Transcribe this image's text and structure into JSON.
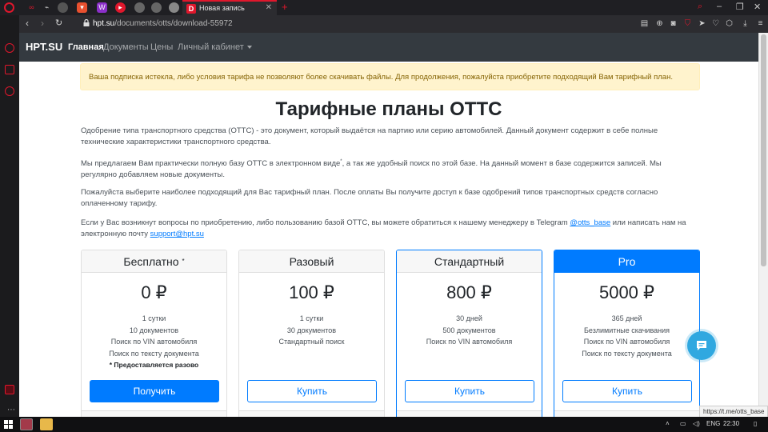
{
  "browser": {
    "active_tab_title": "Новая запись",
    "active_tab_favicon": "D",
    "url_host": "hpt.su",
    "url_path": "/documents/otts/download-55972",
    "new_tab_symbol": "+",
    "close_tab_symbol": "✕",
    "accent_color": "#e0172c"
  },
  "navbar": {
    "brand": "HPT.SU",
    "items": [
      {
        "label": "Главная",
        "active": true
      },
      {
        "label": "Документы",
        "active": false
      },
      {
        "label": "Цены",
        "active": false
      },
      {
        "label": "Личный кабинет",
        "active": false,
        "dropdown": true
      }
    ]
  },
  "alert": {
    "text": "Ваша подписка истекла, либо условия тарифа не позволяют более скачивать файлы. Для продолжения, пожалуйста приобретите подходящий Вам тарифный план."
  },
  "title": "Тарифные планы ОТТС",
  "intro": {
    "p1": "Одобрение типа транспортного средства (ОТТС) - это документ, который выдаётся на партию или серию автомобилей. Данный документ содержит в себе полные технические характеристики транспортного средства.",
    "p2_before": "Мы предлагаем Вам практически полную базу ОТТС в электронном виде",
    "p2_sup": "*",
    "p2_after": ", а так же удобный поиск по этой базе. На данный момент в базе содержится записей. Мы регулярно добавляем новые документы.",
    "p3": "Пожалуйста выберите наиболее подходящий для Вас тарифный план. После оплаты Вы получите доступ к базе одобрений типов транспортных средств согласно оплаченному тарифу.",
    "p4_before": "Если у Вас возникнут вопросы по приобретению, либо пользованию базой ОТТС, вы можете обратиться к нашему менеджеру в Telegram ",
    "p4_telegram": "@otts_base",
    "p4_middle": " или написать нам на электронную почту ",
    "p4_email": "support@hpt.su"
  },
  "plans": [
    {
      "name": "Бесплатно",
      "sup": "*",
      "price": "0 ₽",
      "features": [
        "1 сутки",
        "10 документов",
        "Поиск по VIN автомобиля",
        "Поиск по тексту документа"
      ],
      "note": "* Предоставляется разово",
      "button": "Получить"
    },
    {
      "name": "Разовый",
      "price": "100 ₽",
      "features": [
        "1 сутки",
        "30 документов",
        "Стандартный поиск"
      ],
      "button": "Купить"
    },
    {
      "name": "Стандартный",
      "price": "800 ₽",
      "features": [
        "30 дней",
        "500 документов",
        "Поиск по VIN автомобиля"
      ],
      "button": "Купить"
    },
    {
      "name": "Pro",
      "price": "5000 ₽",
      "features": [
        "365 дней",
        "Безлимитные скачивания",
        "Поиск по VIN автомобиля",
        "Поиск по тексту документа"
      ],
      "button": "Купить"
    }
  ],
  "status_tooltip": "https://t.me/otts_base",
  "taskbar": {
    "language": "ENG",
    "time": "22:30"
  },
  "colors": {
    "primary": "#007bff",
    "navbar_bg": "#343a40",
    "alert_bg": "#fff3cd",
    "chat_button": "#30a8e0"
  }
}
